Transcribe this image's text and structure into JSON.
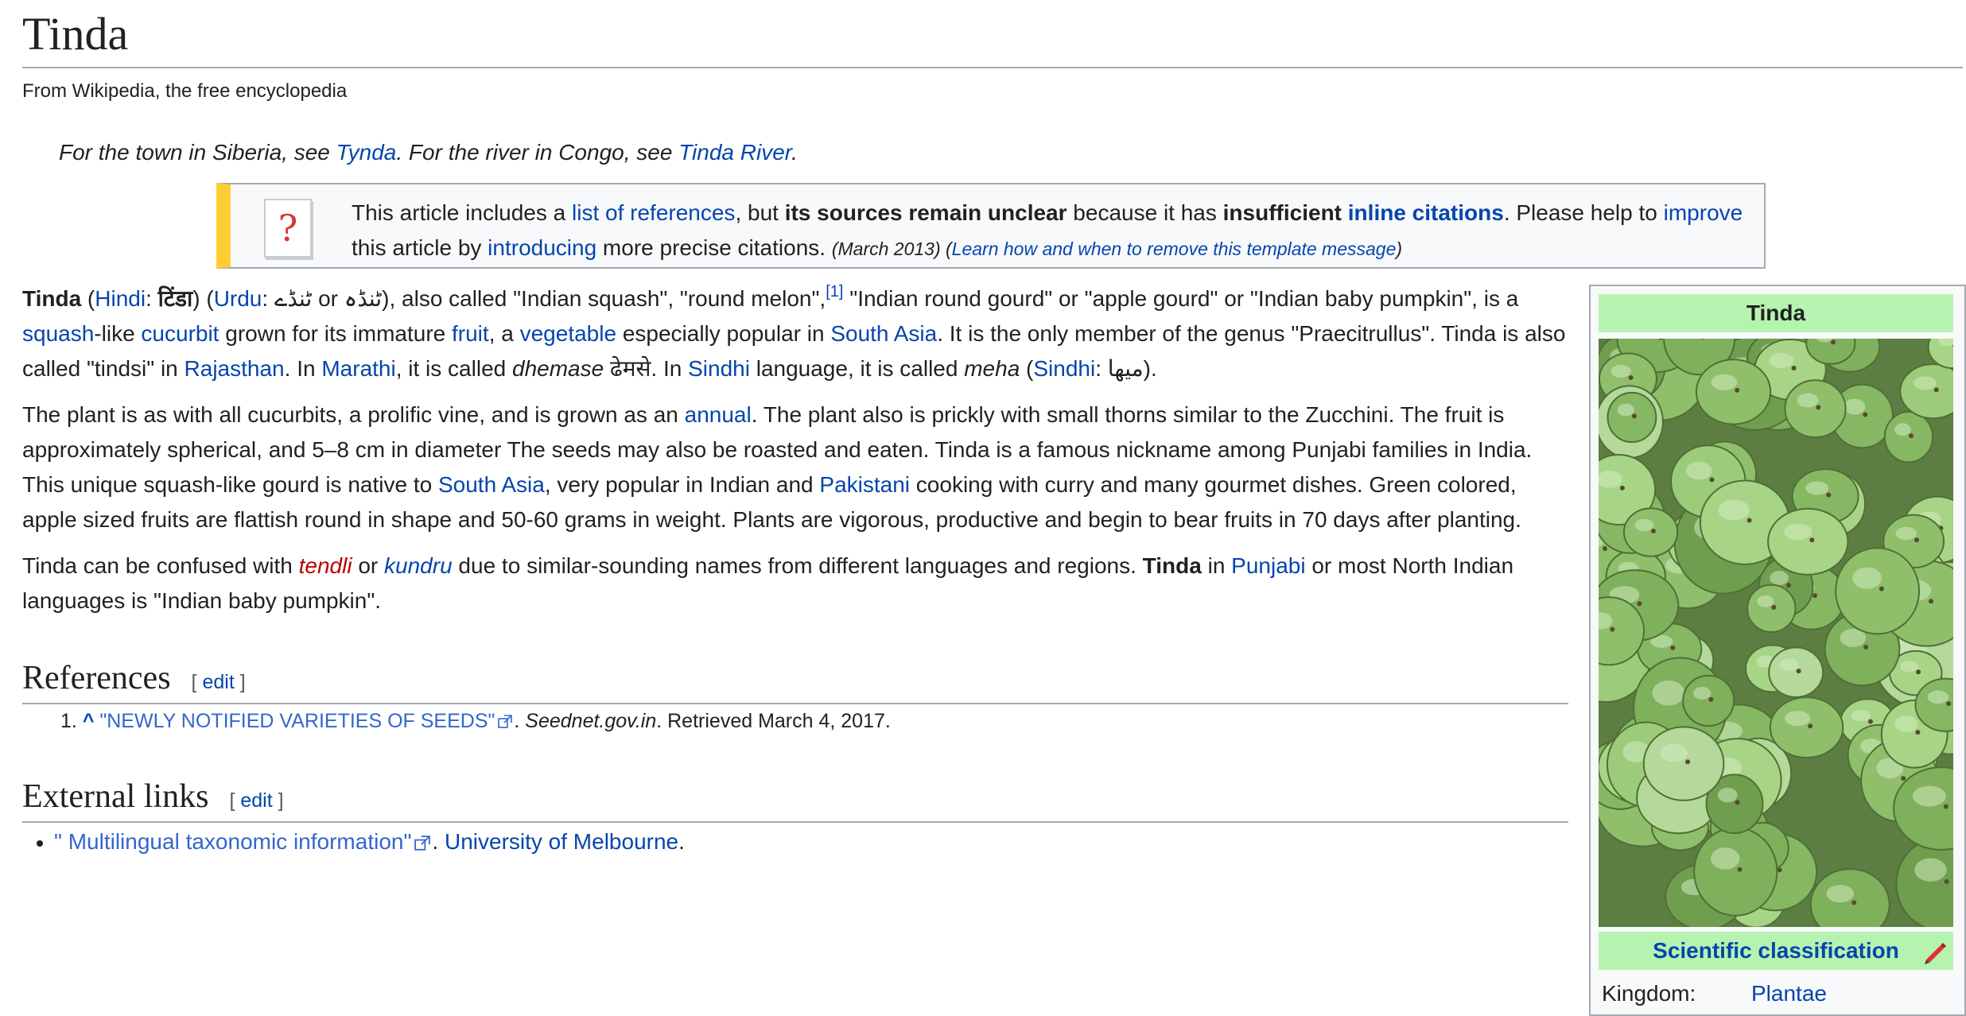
{
  "page": {
    "title": "Tinda",
    "site_sub": "From Wikipedia, the free encyclopedia"
  },
  "hatnote": {
    "t1": "For the town in Siberia, see ",
    "link1": "Tynda",
    "t2": ". For the river in Congo, see ",
    "link2": "Tinda River",
    "t3": "."
  },
  "ambox": {
    "icon": "question-mark-icon",
    "t1": "This article includes a ",
    "link1": "list of references",
    "t2": ", but ",
    "bold1": "its sources remain unclear",
    "t3": " because it has ",
    "bold2": "insufficient ",
    "link2": "inline citations",
    "t4": ". Please help to ",
    "link3": "improve",
    "t5": " this article by ",
    "link4": "introducing",
    "t6": " more precise citations. ",
    "date": "(March 2013)",
    "remove_open": " (",
    "remove_link": "Learn how and when to remove this template message",
    "remove_close": ")"
  },
  "p1": {
    "bold": "Tinda",
    "a": " (",
    "hindi_link": "Hindi",
    "b": ": ",
    "hindi_script": "टिंडा",
    "c": ") (",
    "urdu_link": "Urdu",
    "d": ": ",
    "urdu1": "ٹنڈے",
    "e": " or ",
    "urdu2": "ٹنڈہ",
    "f": "), also called \"Indian squash\", \"round melon\",",
    "cite": "[1]",
    "g": " \"Indian round gourd\" or \"apple gourd\" or \"Indian baby pumpkin\", is a ",
    "squash": "squash",
    "h": "-like ",
    "cucurbit": "cucurbit",
    "i": " grown for its immature ",
    "fruit": "fruit",
    "j": ", a ",
    "vegetable": "vegetable",
    "k": " especially popular in ",
    "south_asia": "South Asia",
    "l": ". It is the only member of the genus \"Praecitrullus\". Tinda is also called \"tindsi\" in ",
    "rajasthan": "Rajasthan",
    "m": ". In ",
    "marathi": "Marathi",
    "n": ", it is called ",
    "dhemase": "dhemase",
    "o": " ढेमसे. In ",
    "sindhi": "Sindhi",
    "p": " language, it is called ",
    "meha": "meha",
    "q": " (",
    "sindhi2": "Sindhi",
    "r": ": ",
    "sindhi_script": "ميها",
    "s": ")."
  },
  "p2": {
    "a": "The plant is as with all cucurbits, a prolific vine, and is grown as an ",
    "annual": "annual",
    "b": ". The plant also is prickly with small thorns similar to the Zucchini. The fruit is approximately spherical, and 5–8 cm in diameter The seeds may also be roasted and eaten. Tinda is a famous nickname among Punjabi families in India. This unique squash-like gourd is native to ",
    "south_asia": "South Asia",
    "c": ", very popular in Indian and ",
    "pakistani": "Pakistani",
    "d": " cooking with curry and many gourmet dishes. Green colored, apple sized fruits are flattish round in shape and 50-60 grams in weight. Plants are vigorous, productive and begin to bear fruits in 70 days after planting."
  },
  "p3": {
    "a": "Tinda can be confused with ",
    "tendli": "tendli",
    "b": " or ",
    "kundru": "kundru",
    "c": " due to similar-sounding names from different languages and regions. ",
    "bold": "Tinda",
    "d": " in ",
    "punjabi": "Punjabi",
    "e": " or most North Indian languages is \"Indian baby pumpkin\"."
  },
  "references": {
    "heading": "References",
    "edit_open": "[ ",
    "edit": "edit",
    "edit_close": " ]",
    "items": [
      {
        "num": "1.",
        "caret": "^",
        "title": "\"NEWLY NOTIFIED VARIETIES OF SEEDS\"",
        "dot": ". ",
        "work": "Seednet.gov.in",
        "rest": ". Retrieved March 4, 2017."
      }
    ]
  },
  "external": {
    "heading": "External links",
    "edit_open": "[ ",
    "edit": "edit",
    "edit_close": " ]",
    "items": [
      {
        "title": "\" Multilingual taxonomic information\"",
        "dot": ". ",
        "publisher": "University of Melbourne",
        "end": "."
      }
    ]
  },
  "infobox": {
    "title": "Tinda",
    "image_alt": "Pile of green tinda gourds",
    "sci_class": "Scientific classification",
    "sci_icon": "pencil-icon",
    "rows": [
      {
        "label": "Kingdom:",
        "value": "Plantae"
      }
    ]
  },
  "colors": {
    "link": "#0645ad",
    "redlink": "#ba0000",
    "ambox_stripe": "#ffcc33",
    "infobox_header": "#b6f3b0"
  }
}
